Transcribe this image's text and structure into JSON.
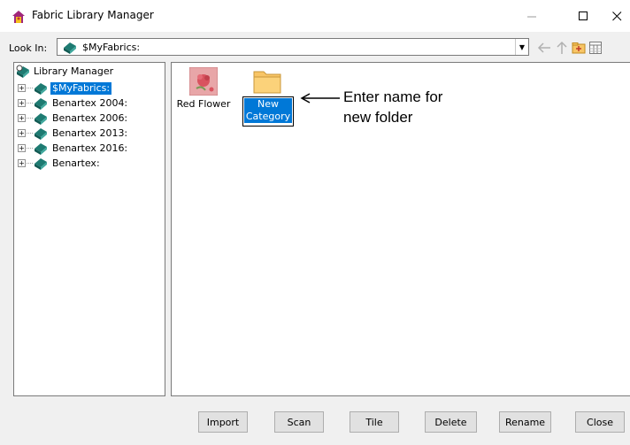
{
  "window": {
    "title": "Fabric Library Manager"
  },
  "toolbar": {
    "look_in_label": "Look In:",
    "look_in_value": "$MyFabrics:"
  },
  "tree": {
    "root_label": "Library Manager",
    "items": [
      {
        "label": "$MyFabrics:",
        "selected": true
      },
      {
        "label": "Benartex 2004:",
        "selected": false
      },
      {
        "label": "Benartex 2006:",
        "selected": false
      },
      {
        "label": "Benartex 2013:",
        "selected": false
      },
      {
        "label": "Benartex 2016:",
        "selected": false
      },
      {
        "label": "Benartex:",
        "selected": false
      }
    ]
  },
  "content": {
    "items": [
      {
        "label": "Red Flower",
        "icon": "fabric-swatch-icon"
      },
      {
        "label_line1": "New",
        "label_line2": "Category",
        "icon": "folder-icon",
        "editing": true
      }
    ]
  },
  "annotation": {
    "line1": "Enter name for",
    "line2": "new folder"
  },
  "buttons": {
    "import": "Import",
    "scan": "Scan",
    "tile": "Tile",
    "delete": "Delete",
    "rename": "Rename",
    "close": "Close"
  },
  "colors": {
    "selection": "#0078d7",
    "folder": "#f8c566",
    "library_icon": "#1e7b72",
    "fabric": "#d9535f"
  }
}
